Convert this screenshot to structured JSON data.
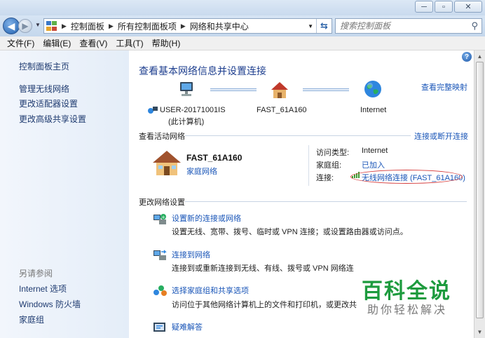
{
  "window": {
    "minimize_glyph": "─",
    "maximize_glyph": "▫",
    "close_glyph": "✕"
  },
  "address_bar": {
    "crumbs": [
      "控制面板",
      "所有控制面板项",
      "网络和共享中心"
    ],
    "search_placeholder": "搜索控制面板"
  },
  "menubar": {
    "items": [
      "文件(F)",
      "编辑(E)",
      "查看(V)",
      "工具(T)",
      "帮助(H)"
    ]
  },
  "sidebar": {
    "items": [
      "控制面板主页",
      "管理无线网络",
      "更改适配器设置",
      "更改高级共享设置"
    ],
    "see_also_title": "另请参阅",
    "see_also": [
      "Internet 选项",
      "Windows 防火墙",
      "家庭组"
    ]
  },
  "main": {
    "title": "查看基本网络信息并设置连接",
    "view_full_map": "查看完整映射",
    "map": {
      "computer_name": "USER-20171001IS",
      "computer_sub": "(此计算机)",
      "network_name": "FAST_61A160",
      "internet_label": "Internet"
    },
    "active_networks": {
      "header": "查看活动网络",
      "connect_link": "连接或断开连接",
      "network_name": "FAST_61A160",
      "network_type": "家庭网络",
      "access_type_label": "访问类型:",
      "access_type_value": "Internet",
      "homegroup_label": "家庭组:",
      "homegroup_value": "已加入",
      "connection_label": "连接:",
      "connection_value": "无线网络连接 (FAST_61A160)"
    },
    "change_settings": {
      "header": "更改网络设置",
      "tasks": [
        {
          "link": "设置新的连接或网络",
          "desc": "设置无线、宽带、拨号、临时或 VPN 连接；或设置路由器或访问点。"
        },
        {
          "link": "连接到网络",
          "desc": "连接到或重新连接到无线、有线、拨号或 VPN 网络连"
        },
        {
          "link": "选择家庭组和共享选项",
          "desc": "访问位于其他网络计算机上的文件和打印机，或更改共"
        },
        {
          "link": "疑难解答",
          "desc": ""
        }
      ]
    }
  },
  "watermark": {
    "title": "百科全说",
    "subtitle": "助你轻松解决"
  },
  "colors": {
    "link": "#1a56b8",
    "title": "#1e3f8f",
    "watermark": "#1d9b3e",
    "highlight_circle": "#d43a3a"
  }
}
